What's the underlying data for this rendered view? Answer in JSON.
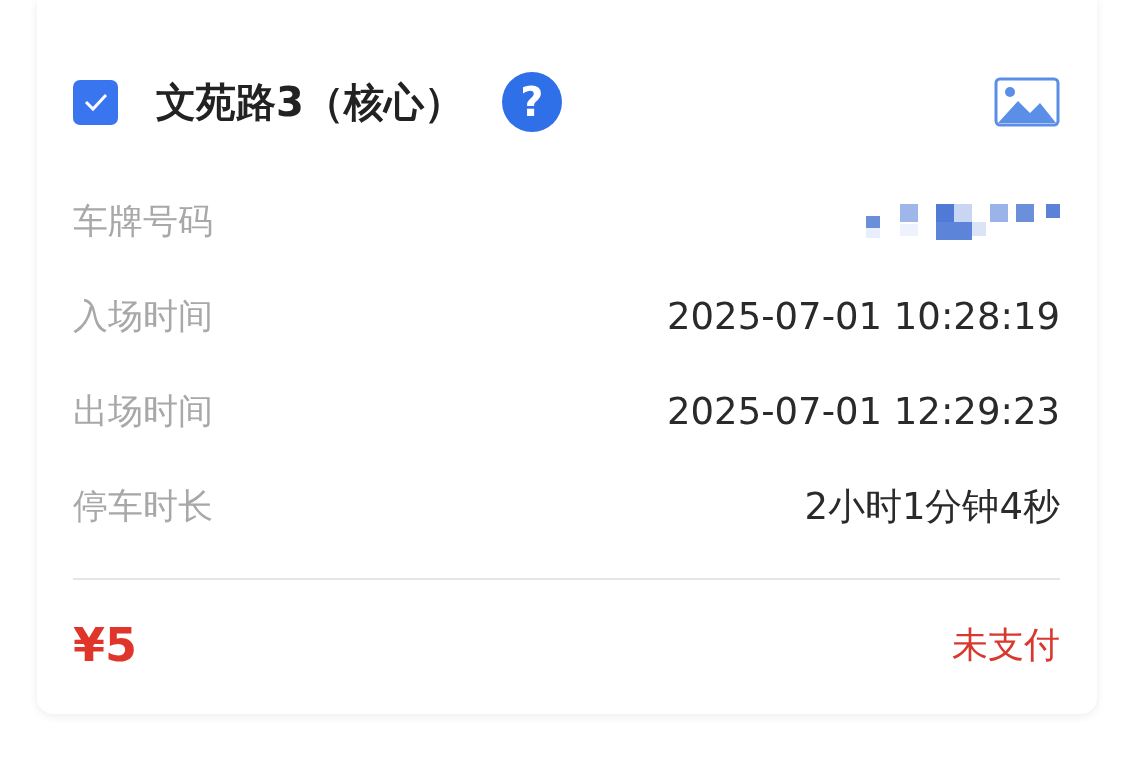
{
  "parking_record": {
    "checked": true,
    "lot_name": "文苑路3（核心）",
    "help_icon_text": "?",
    "fields": [
      {
        "label": "车牌号码",
        "kind": "redacted"
      },
      {
        "label": "入场时间",
        "kind": "text",
        "value": "2025-07-01 10:28:19"
      },
      {
        "label": "出场时间",
        "kind": "text",
        "value": "2025-07-01 12:29:23"
      },
      {
        "label": "停车时长",
        "kind": "text",
        "value": "2小时1分钟4秒"
      }
    ],
    "amount": "¥5",
    "payment_status": "未支付"
  }
}
